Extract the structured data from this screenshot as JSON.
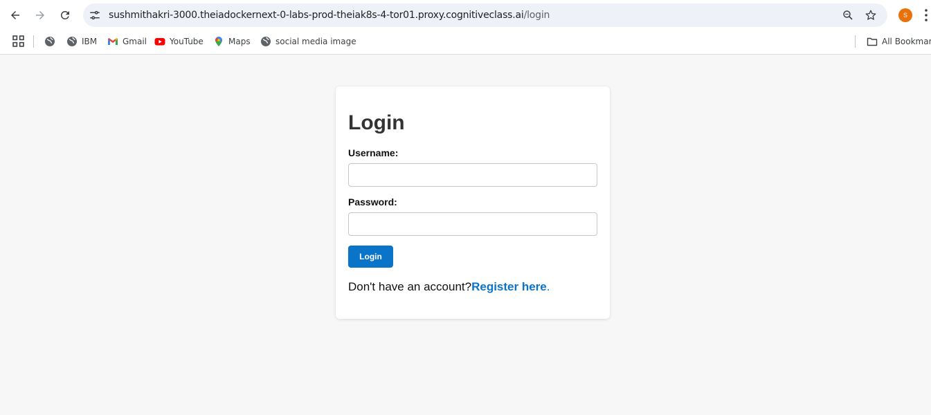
{
  "browser": {
    "url_host": "sushmithakri-3000.theiadockernext-0-labs-prod-theiak8s-4-tor01.proxy.cognitiveclass.ai",
    "url_path": "/login",
    "profile_initial": "S"
  },
  "bookmarks": {
    "items": [
      {
        "label": "IBM",
        "icon": "globe-icon"
      },
      {
        "label": "Gmail",
        "icon": "gmail-icon"
      },
      {
        "label": "YouTube",
        "icon": "youtube-icon"
      },
      {
        "label": "Maps",
        "icon": "maps-icon"
      },
      {
        "label": "social media image",
        "icon": "globe-icon"
      }
    ],
    "all_bookmarks": "All Bookmarks"
  },
  "login": {
    "title": "Login",
    "username_label": "Username:",
    "password_label": "Password:",
    "username_value": "",
    "password_value": "",
    "button_label": "Login",
    "register_prompt": "Don't have an account?",
    "register_link": "Register here",
    "register_suffix": ".",
    "accent_color": "#0a74c8"
  }
}
